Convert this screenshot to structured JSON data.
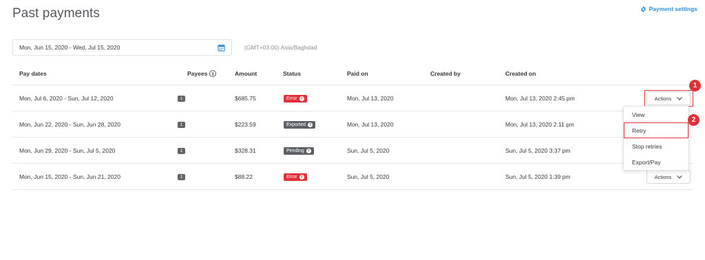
{
  "header": {
    "title": "Past payments",
    "settings_label": "Payment settings",
    "settings_icon": "gear-icon"
  },
  "filter": {
    "date_range": "Mon, Jun 15, 2020 - Wed, Jul 15, 2020",
    "calendar_icon": "calendar-icon",
    "timezone": "(GMT+03:00) Asia/Baghdad"
  },
  "table": {
    "columns": [
      "Pay dates",
      "Payees",
      "Amount",
      "Status",
      "Paid on",
      "Created by",
      "Created on"
    ],
    "info_glyph": "i",
    "rows": [
      {
        "pay_dates": "Mon, Jul 6, 2020 - Sun, Jul 12, 2020",
        "payees": "1",
        "amount": "$685.75",
        "status": "Error",
        "paid_on": "Mon, Jul 13, 2020",
        "created_by": "",
        "created_on": "Mon, Jul 13, 2020 2:45 pm",
        "actions": "Actions"
      },
      {
        "pay_dates": "Mon, Jun 22, 2020 - Sun, Jun 28, 2020",
        "payees": "1",
        "amount": "$223.59",
        "status": "Exported",
        "paid_on": "Mon, Jul 13, 2020",
        "created_by": "",
        "created_on": "Mon, Jul 13, 2020 2:11 pm",
        "actions": ""
      },
      {
        "pay_dates": "Mon, Jun 29, 2020 - Sun, Jul 5, 2020",
        "payees": "1",
        "amount": "$328.31",
        "status": "Pending",
        "paid_on": "Sun, Jul 5, 2020",
        "created_by": "",
        "created_on": "Sun, Jul 5, 2020 3:37 pm",
        "actions": ""
      },
      {
        "pay_dates": "Mon, Jun 15, 2020 - Sun, Jun 21, 2020",
        "payees": "1",
        "amount": "$88.22",
        "status": "Error",
        "paid_on": "Sun, Jul 5, 2020",
        "created_by": "",
        "created_on": "Sun, Jul 5, 2020 1:39 pm",
        "actions": "Actions"
      }
    ]
  },
  "dropdown": {
    "items": [
      "View",
      "Retry",
      "Stop retries",
      "Export/Pay"
    ]
  },
  "annotations": {
    "step1": "1",
    "step2": "2"
  },
  "colors": {
    "accent": "#2f8bd8",
    "error": "#e0313b",
    "neutral_badge": "#5c6064"
  }
}
